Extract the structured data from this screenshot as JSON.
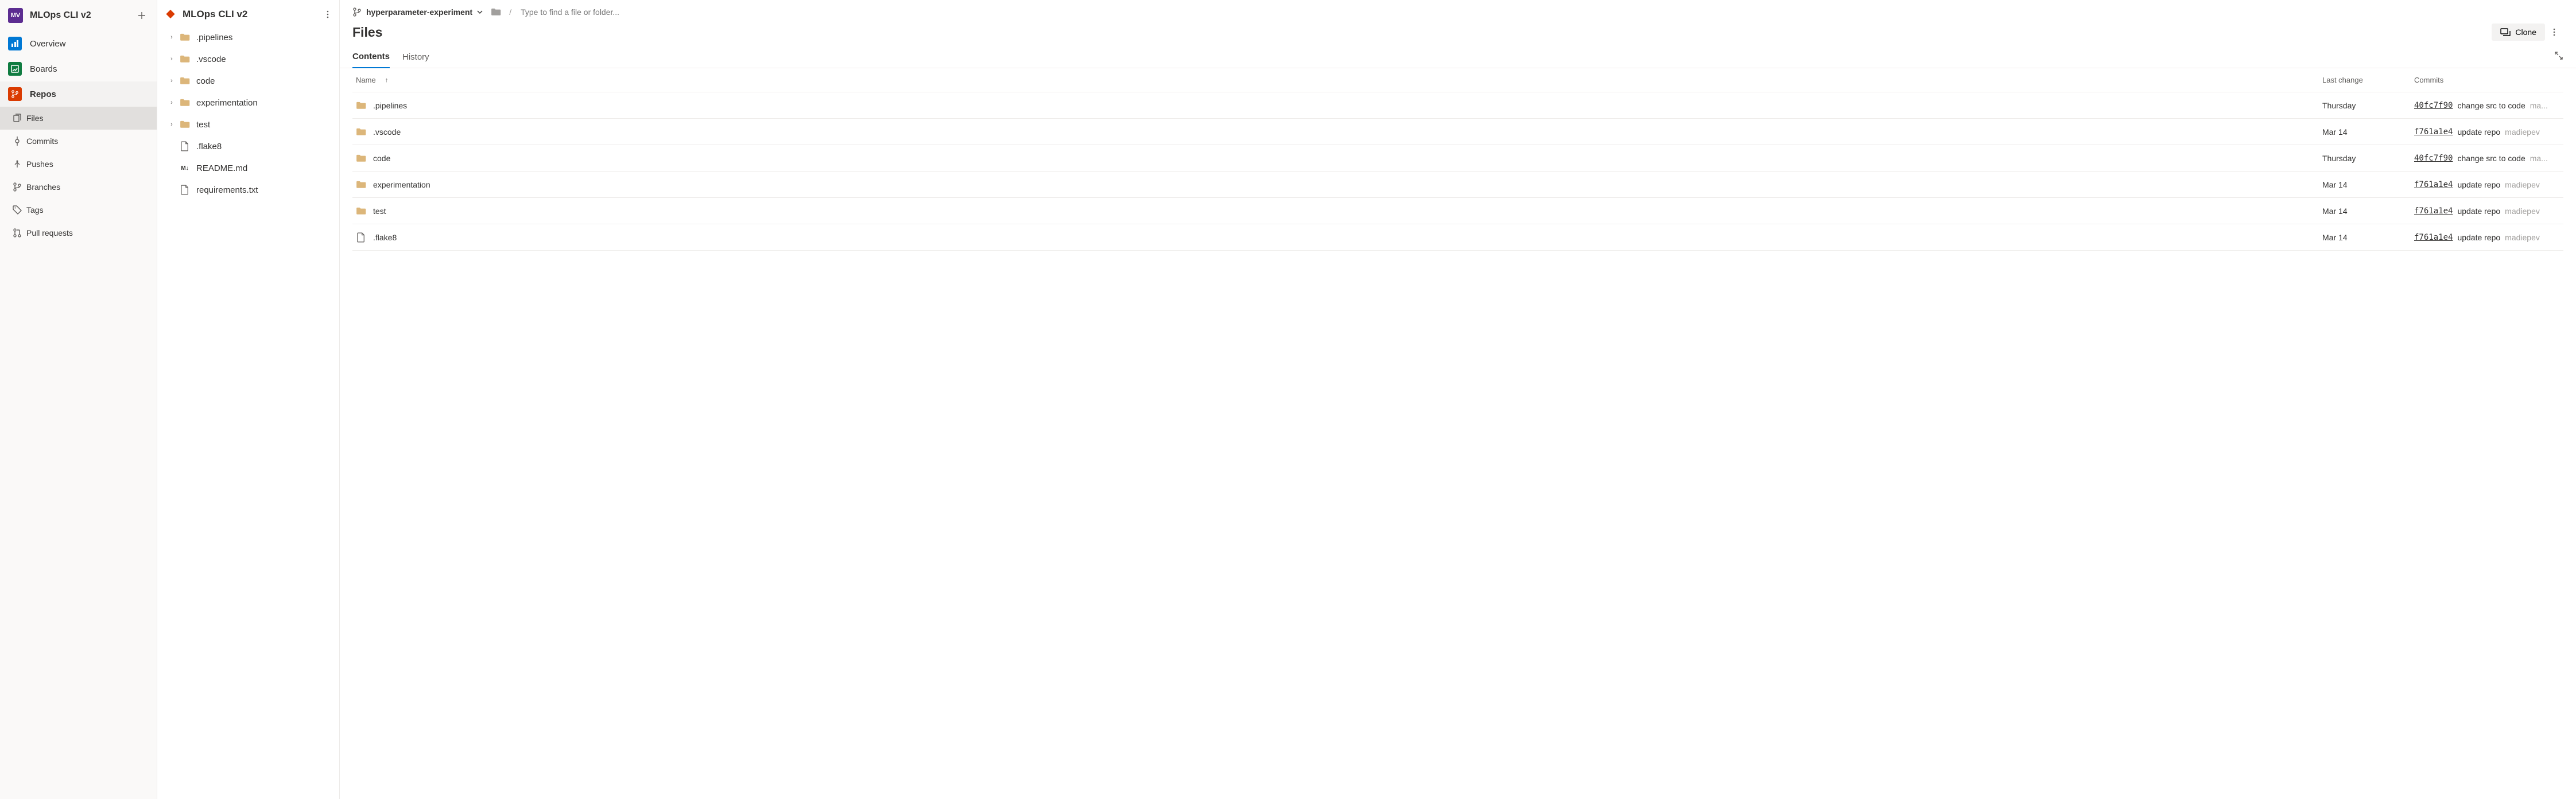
{
  "project": {
    "avatar_initials": "MV",
    "name": "MLOps CLI v2"
  },
  "nav": {
    "add_tooltip": "+",
    "items": [
      {
        "key": "overview",
        "label": "Overview"
      },
      {
        "key": "boards",
        "label": "Boards"
      },
      {
        "key": "repos",
        "label": "Repos",
        "selected": true
      }
    ],
    "sub_items": [
      {
        "key": "files",
        "label": "Files",
        "selected": true
      },
      {
        "key": "commits",
        "label": "Commits"
      },
      {
        "key": "pushes",
        "label": "Pushes"
      },
      {
        "key": "branches",
        "label": "Branches"
      },
      {
        "key": "tags",
        "label": "Tags"
      },
      {
        "key": "pulls",
        "label": "Pull requests"
      }
    ]
  },
  "tree": {
    "repo_name": "MLOps CLI v2",
    "nodes": [
      {
        "type": "folder",
        "name": ".pipelines",
        "expandable": true
      },
      {
        "type": "folder",
        "name": ".vscode",
        "expandable": true
      },
      {
        "type": "folder",
        "name": "code",
        "expandable": true
      },
      {
        "type": "folder",
        "name": "experimentation",
        "expandable": true
      },
      {
        "type": "folder",
        "name": "test",
        "expandable": true
      },
      {
        "type": "file",
        "name": ".flake8",
        "icon": "file"
      },
      {
        "type": "file",
        "name": "README.md",
        "icon": "md"
      },
      {
        "type": "file",
        "name": "requirements.txt",
        "icon": "file"
      }
    ]
  },
  "main": {
    "branch": "hyperparameter-experiment",
    "path_sep": "/",
    "path_placeholder": "Type to find a file or folder...",
    "title": "Files",
    "clone_label": "Clone",
    "tabs": [
      {
        "key": "contents",
        "label": "Contents",
        "active": true
      },
      {
        "key": "history",
        "label": "History"
      }
    ],
    "columns": {
      "name": "Name",
      "change": "Last change",
      "commits": "Commits"
    },
    "rows": [
      {
        "type": "folder",
        "name": ".pipelines",
        "change": "Thursday",
        "sha": "40fc7f90",
        "msg": "change src to code",
        "author": "ma..."
      },
      {
        "type": "folder",
        "name": ".vscode",
        "change": "Mar 14",
        "sha": "f761a1e4",
        "msg": "update repo",
        "author": "madiepev"
      },
      {
        "type": "folder",
        "name": "code",
        "change": "Thursday",
        "sha": "40fc7f90",
        "msg": "change src to code",
        "author": "ma..."
      },
      {
        "type": "folder",
        "name": "experimentation",
        "change": "Mar 14",
        "sha": "f761a1e4",
        "msg": "update repo",
        "author": "madiepev"
      },
      {
        "type": "folder",
        "name": "test",
        "change": "Mar 14",
        "sha": "f761a1e4",
        "msg": "update repo",
        "author": "madiepev"
      },
      {
        "type": "file",
        "name": ".flake8",
        "change": "Mar 14",
        "sha": "f761a1e4",
        "msg": "update repo",
        "author": "madiepev"
      }
    ]
  }
}
